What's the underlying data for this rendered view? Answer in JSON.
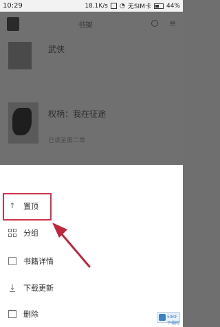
{
  "status_bar": {
    "time": "10:29",
    "speed": "18.1K/s",
    "sim": "无SIM卡",
    "battery": "44%"
  },
  "header": {
    "title": "书架"
  },
  "books": [
    {
      "title": "武侠",
      "subtitle": ""
    },
    {
      "title": "权柄：我在征途",
      "subtitle": "已读至第二章"
    }
  ],
  "menu": {
    "items": [
      {
        "label": "置顶",
        "icon": "pin-icon"
      },
      {
        "label": "分组",
        "icon": "group-icon"
      },
      {
        "label": "书籍详情",
        "icon": "book-detail-icon"
      },
      {
        "label": "下载更新",
        "icon": "download-icon"
      },
      {
        "label": "删除",
        "icon": "delete-icon"
      }
    ]
  },
  "annotation": {
    "highlight_color": "#d0334a",
    "arrow_color": "#c0263c"
  },
  "watermark": {
    "text": "59KF下载网"
  }
}
